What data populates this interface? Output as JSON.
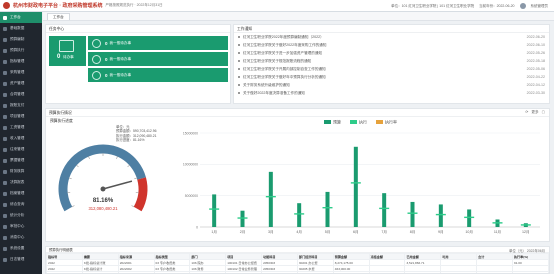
{
  "header": {
    "brand": "杭州市财政电子平台 · 政府采购管理系统",
    "subtitle": "严格按照规范执行 · 2022年12月31日",
    "info": "单位：101 红河卫生职业学院 | 101 红河卫生职业学院",
    "user_date": "当前年份：2022-06-20",
    "account": "系统管理员"
  },
  "sidebar": {
    "items": [
      {
        "label": "工作台",
        "active": true
      },
      {
        "label": "基础数据"
      },
      {
        "label": "预算编制"
      },
      {
        "label": "预算执行"
      },
      {
        "label": "指标管理"
      },
      {
        "label": "采购管理"
      },
      {
        "label": "资产管理"
      },
      {
        "label": "合同管理"
      },
      {
        "label": "报账支付"
      },
      {
        "label": "项目管理"
      },
      {
        "label": "工资管理"
      },
      {
        "label": "收入管理"
      },
      {
        "label": "往来管理"
      },
      {
        "label": "票据管理"
      },
      {
        "label": "财务核算"
      },
      {
        "label": "决算报表"
      },
      {
        "label": "档案管理"
      },
      {
        "label": "综合查询"
      },
      {
        "label": "统计分析"
      },
      {
        "label": "审批中心"
      },
      {
        "label": "消息中心"
      },
      {
        "label": "系统设置"
      },
      {
        "label": "日志管理"
      }
    ]
  },
  "tabs": [
    {
      "label": "工作台"
    }
  ],
  "task_center": {
    "title": "任务中心",
    "big_tile": {
      "value": "0",
      "label": "待办事"
    },
    "tiles": [
      {
        "value": "0",
        "label": "我一般待办事"
      },
      {
        "value": "0",
        "label": "我一般待办事"
      },
      {
        "value": "0",
        "label": "我一般待办事"
      }
    ]
  },
  "notices": {
    "title": "工作通知",
    "items": [
      {
        "text": "红河卫生职业学院2022年度预算编制通知（2022）",
        "date": "2022-06-20"
      },
      {
        "text": "红河卫生职业学院关于做好2022年度采购工作的通知",
        "date": "2022-06-10"
      },
      {
        "text": "红河卫生职业学院关于进一步加强资产管理的通知",
        "date": "2022-05-26"
      },
      {
        "text": "红河卫生职业学院关于规范报账流程的通知",
        "date": "2022-05-18"
      },
      {
        "text": "红河卫生职业学院关于开展内部控制自查工作的通知",
        "date": "2022-05-06"
      },
      {
        "text": "红河卫生职业学院关于做好年中预算执行分析的通知",
        "date": "2022-04-22"
      },
      {
        "text": "关于财务系统升级维护的通知",
        "date": "2022-04-12"
      },
      {
        "text": "关于做好2022年度决算准备工作的通知",
        "date": "2022-03-30"
      }
    ]
  },
  "budget": {
    "title": "预算执行情况",
    "tools": [
      "⟳",
      "更多",
      "▢"
    ],
    "gauge": {
      "title": "预算执行进度",
      "unit": "单位：元",
      "meta": [
        "预算金额：590,703,412.96",
        "执行金额：312,090,480.21",
        "执行进度：81.16%"
      ],
      "percent": 81.16,
      "percent_label": "81.16%",
      "amount_label": "312,080,480.21",
      "color_ok": "#1a9b6f",
      "color_warn": "#d0342c"
    }
  },
  "chart_data": {
    "type": "bar",
    "categories": [
      "1月",
      "2月",
      "3月",
      "4月",
      "5月",
      "6月",
      "7月",
      "8月",
      "9月",
      "10月",
      "11月",
      "12月"
    ],
    "series": [
      {
        "name": "预算",
        "values": [
          0,
          0,
          0,
          0,
          0,
          0,
          0,
          0,
          0,
          0,
          0,
          0
        ]
      },
      {
        "name": "执行",
        "values": [
          5200000,
          2600000,
          8800000,
          3800000,
          5600000,
          12800000,
          5400000,
          4000000,
          3600000,
          2800000,
          1200000,
          600000
        ]
      },
      {
        "name": "执行率",
        "values": [
          0,
          0,
          0,
          0,
          0,
          0,
          0,
          0,
          0,
          0,
          0,
          0
        ]
      }
    ],
    "ylim": [
      0,
      15000000
    ],
    "yticks": [
      "0",
      "5000000",
      "10000000",
      "15000000"
    ],
    "legend_position": "top-center",
    "colors": [
      "#1a9b6f",
      "#2ecc8a",
      "#e6a23c"
    ]
  },
  "detail": {
    "title": "预算执行明细表",
    "tools": "单位（元） 2022年06月",
    "columns": [
      "指标号",
      "摘要",
      "指标来源",
      "指标类型",
      "部门",
      "项目",
      "功能科目",
      "部门经济科目",
      "预算金额",
      "冻结金额",
      "已用金额",
      "可用",
      "合计",
      "执行率(%)"
    ],
    "rows": [
      [
        "2022",
        "K批-指标总计账",
        "2022001",
        "03 专户收费类",
        "106 院办",
        "100101 日常办公经费",
        "2050303",
        "30201 办公费",
        "8,274,175.00",
        "",
        "3,521,866.71",
        "",
        "",
        "91.00"
      ],
      [
        "2022",
        "K批-指标总计",
        "2022002",
        "03 专户收费类",
        "106 财务",
        "100102 日常业务管理",
        "2050303",
        "30205 水费",
        "463,000.00",
        "",
        "",
        "",
        "",
        ""
      ],
      [
        "2022",
        "K批-指标总计",
        "2022003",
        "03 专户收费类",
        "106 教务",
        "100103 教学业务支出",
        "2050303",
        "30206 电费",
        "4,250.00",
        "",
        "",
        "",
        "",
        ""
      ],
      [
        "2022",
        "K批-指标总计",
        "2022004",
        "03 专户收费类",
        "106 学工",
        "100104 学生管理支出",
        "2050303",
        "30207 邮电费",
        "4,500.00",
        "",
        "",
        "",
        "",
        ""
      ]
    ]
  }
}
